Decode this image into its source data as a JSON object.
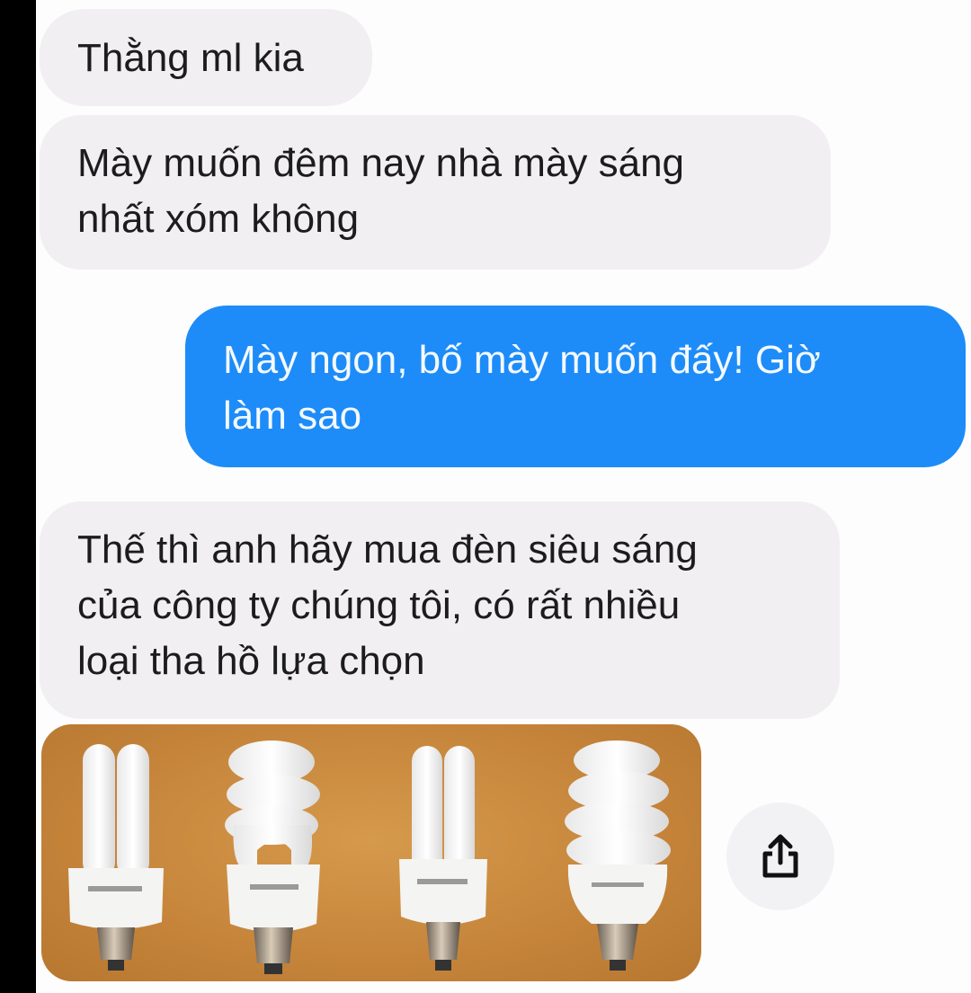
{
  "conversation": {
    "messages": [
      {
        "direction": "incoming",
        "lines": [
          "Thằng ml kia"
        ]
      },
      {
        "direction": "incoming",
        "lines": [
          "Mày muốn đêm nay nhà mày sáng",
          "nhất xóm không"
        ]
      },
      {
        "direction": "outgoing",
        "lines": [
          "Mày ngon, bố mày muốn đấy! Giờ",
          "làm sao"
        ]
      },
      {
        "direction": "incoming",
        "lines": [
          "Thế thì anh hãy mua đèn siêu sáng",
          "của công ty chúng tôi, có rất nhiều",
          "loại tha hồ lựa chọn"
        ]
      }
    ],
    "attachment": {
      "kind": "image",
      "subject": "compact fluorescent light bulbs",
      "bulb_count": 4
    },
    "share_icon": "share-icon"
  },
  "colors": {
    "incoming_bubble": "#f1eff2",
    "outgoing_bubble": "#1d8cf8",
    "attachment_background": "#c5843a"
  }
}
